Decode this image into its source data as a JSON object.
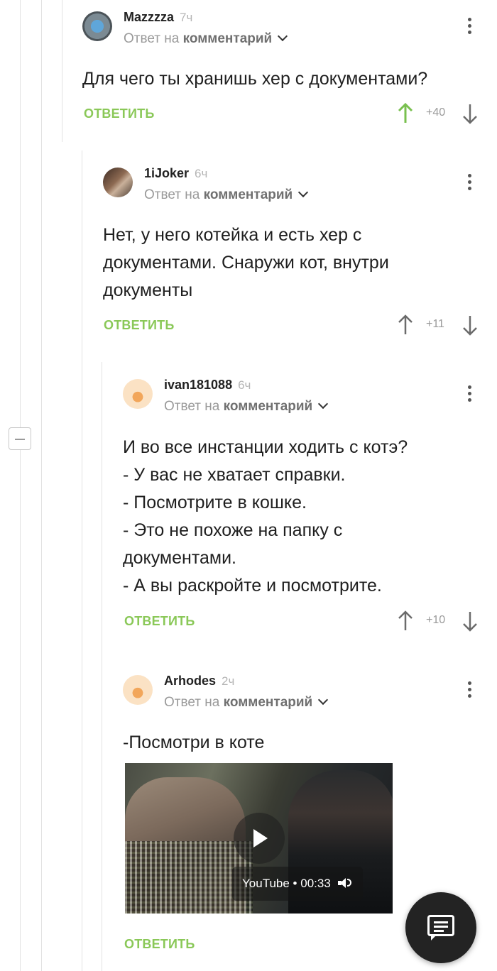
{
  "comments": [
    {
      "username": "Mazzzza",
      "time": "7ч",
      "reply_prefix": "Ответ на",
      "reply_target": "комментарий",
      "text_lines": [
        "Для чего ты хранишь хер с документами?"
      ],
      "reply_label": "ОТВЕТИТЬ",
      "score": "+40",
      "upvoted": true
    },
    {
      "username": "1iJoker",
      "time": "6ч",
      "reply_prefix": "Ответ на",
      "reply_target": "комментарий",
      "text_lines": [
        "Нет, у него котейка и есть хер с",
        "документами. Снаружи кот, внутри",
        "документы"
      ],
      "reply_label": "ОТВЕТИТЬ",
      "score": "+11",
      "upvoted": false
    },
    {
      "username": "ivan181088",
      "time": "6ч",
      "reply_prefix": "Ответ на",
      "reply_target": "комментарий",
      "text_lines": [
        "И во все инстанции ходить с котэ?",
        "- У вас не хватает справки.",
        "- Посмотрите в кошке.",
        "- Это не похоже на папку с",
        "документами.",
        "- А вы раскройте и посмотрите."
      ],
      "reply_label": "ОТВЕТИТЬ",
      "score": "+10",
      "upvoted": false
    },
    {
      "username": "Arhodes",
      "time": "2ч",
      "reply_prefix": "Ответ на",
      "reply_target": "комментарий",
      "text_lines": [
        "-Посмотри в коте"
      ],
      "reply_label": "ОТВЕТИТЬ",
      "video": {
        "source": "YouTube",
        "separator": "•",
        "duration": "00:33"
      }
    }
  ],
  "colors": {
    "accent_green": "#8ac858",
    "text": "#1f1f1f",
    "muted": "#9a9a9a",
    "fab": "#232323"
  },
  "icons": [
    "ellipsis-vertical-icon",
    "chevron-down-icon",
    "arrow-up-icon",
    "arrow-down-icon",
    "play-icon",
    "volume-icon",
    "comment-icon",
    "collapse-icon"
  ]
}
